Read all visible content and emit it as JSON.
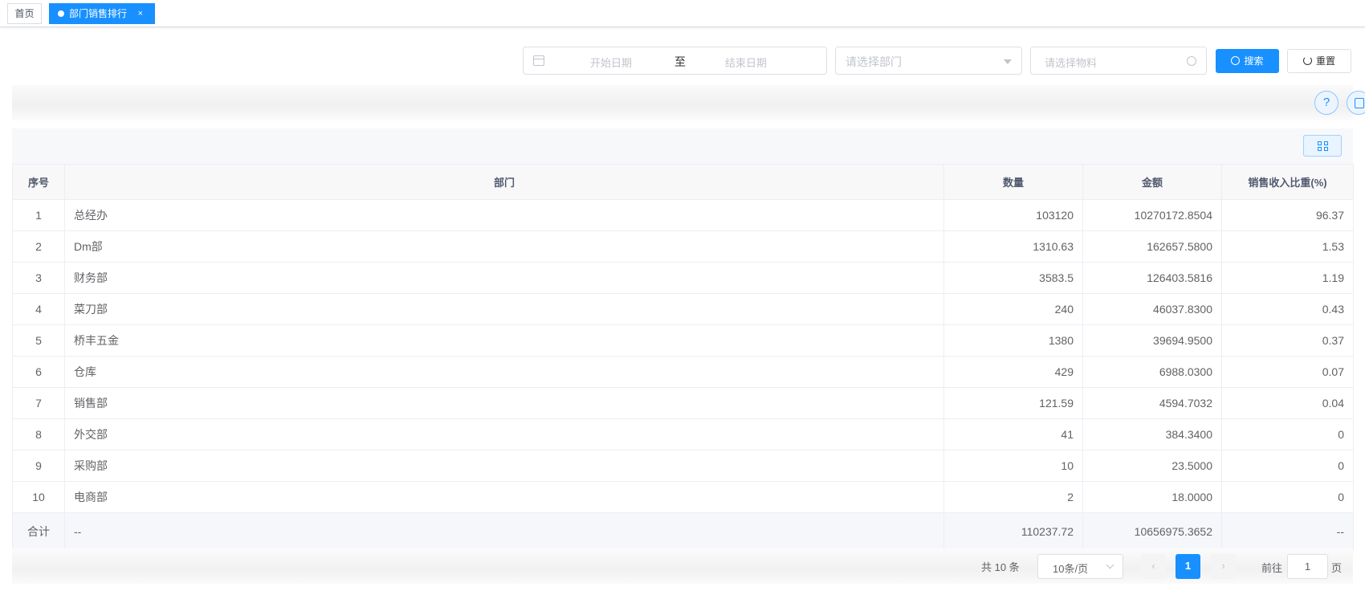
{
  "tabs": {
    "home": "首页",
    "active": "部门销售排行",
    "close": "×"
  },
  "search": {
    "start_placeholder": "开始日期",
    "range_sep": "至",
    "end_placeholder": "结束日期",
    "dept_placeholder": "请选择部门",
    "material_placeholder": "请选择物料",
    "search_label": "搜索",
    "reset_label": "重置"
  },
  "toolbar": {
    "help": "?"
  },
  "table": {
    "headers": [
      "序号",
      "部门",
      "数量",
      "金额",
      "销售收入比重(%)"
    ],
    "rows": [
      [
        "1",
        "总经办",
        "103120",
        "10270172.8504",
        "96.37"
      ],
      [
        "2",
        "Dm部",
        "1310.63",
        "162657.5800",
        "1.53"
      ],
      [
        "3",
        "财务部",
        "3583.5",
        "126403.5816",
        "1.19"
      ],
      [
        "4",
        "菜刀部",
        "240",
        "46037.8300",
        "0.43"
      ],
      [
        "5",
        "桥丰五金",
        "1380",
        "39694.9500",
        "0.37"
      ],
      [
        "6",
        "仓库",
        "429",
        "6988.0300",
        "0.07"
      ],
      [
        "7",
        "销售部",
        "121.59",
        "4594.7032",
        "0.04"
      ],
      [
        "8",
        "外交部",
        "41",
        "384.3400",
        "0"
      ],
      [
        "9",
        "采购部",
        "10",
        "23.5000",
        "0"
      ],
      [
        "10",
        "电商部",
        "2",
        "18.0000",
        "0"
      ]
    ],
    "summary": [
      "合计",
      "--",
      "110237.72",
      "10656975.3652",
      "--"
    ]
  },
  "pagination": {
    "total": "共 10 条",
    "page_size": "10条/页",
    "prev": "‹",
    "current": "1",
    "next": "›",
    "goto": "前往",
    "goto_value": "1",
    "unit": "页"
  },
  "colors": {
    "primary": "#1890ff",
    "border": "#ebeef5"
  }
}
